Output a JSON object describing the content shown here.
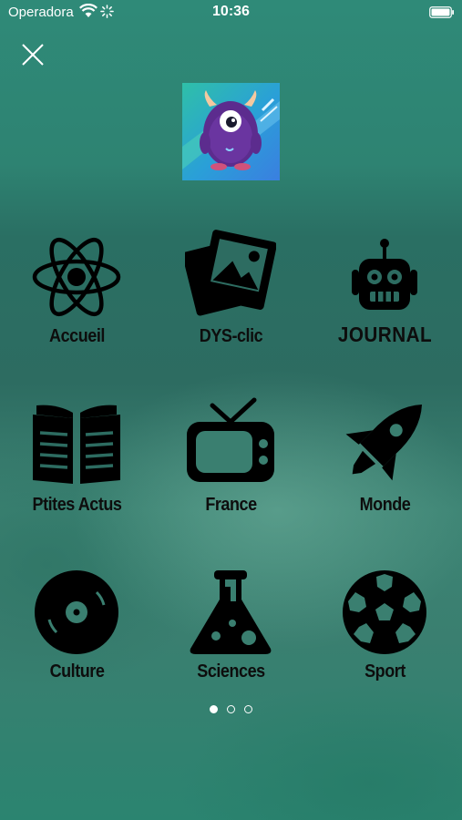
{
  "status_bar": {
    "carrier": "Operadora",
    "time": "10:36"
  },
  "grid": {
    "items": [
      {
        "label": "Accueil",
        "icon": "atom-icon"
      },
      {
        "label": "DYS-clic",
        "icon": "photos-icon"
      },
      {
        "label": "JOURNAL",
        "icon": "robot-icon"
      },
      {
        "label": "Ptites Actus",
        "icon": "open-book-icon"
      },
      {
        "label": "France",
        "icon": "tv-icon"
      },
      {
        "label": "Monde",
        "icon": "rocket-icon"
      },
      {
        "label": "Culture",
        "icon": "vinyl-record-icon"
      },
      {
        "label": "Sciences",
        "icon": "flask-icon"
      },
      {
        "label": "Sport",
        "icon": "soccer-ball-icon"
      }
    ]
  },
  "pagination": {
    "total": 3,
    "active_index": 0
  },
  "colors": {
    "background": "#2e7f6f",
    "icon": "#000000",
    "label": "#0d0d0d",
    "status_text": "#ffffff"
  }
}
